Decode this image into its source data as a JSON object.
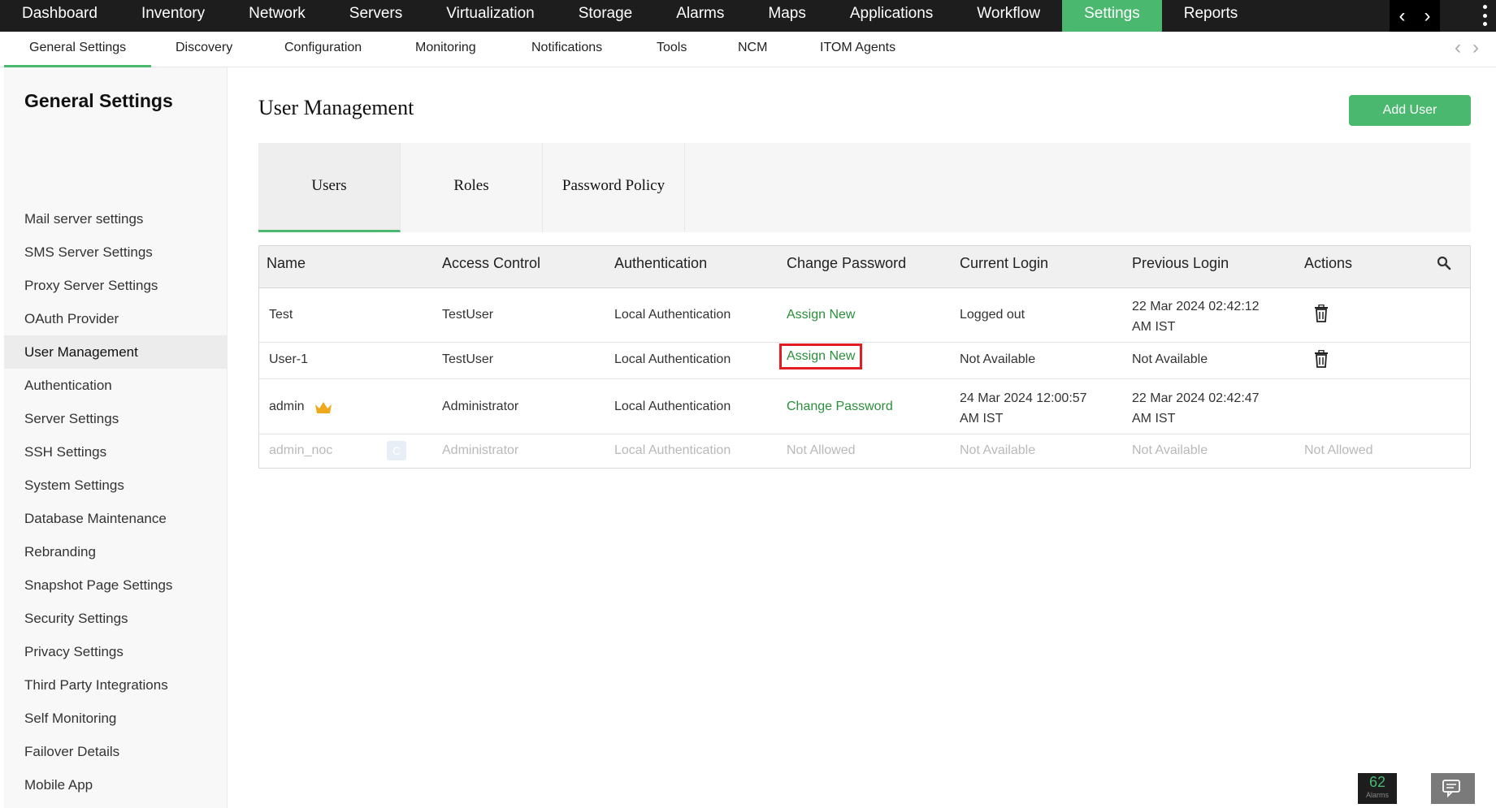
{
  "topnav": {
    "items": [
      "Dashboard",
      "Inventory",
      "Network",
      "Servers",
      "Virtualization",
      "Storage",
      "Alarms",
      "Maps",
      "Applications",
      "Workflow",
      "Settings",
      "Reports"
    ],
    "active": "Settings"
  },
  "subnav": {
    "items": [
      "General Settings",
      "Discovery",
      "Configuration",
      "Monitoring",
      "Notifications",
      "Tools",
      "NCM",
      "ITOM Agents"
    ],
    "active": "General Settings"
  },
  "sidebar": {
    "title": "General Settings",
    "items": [
      "Mail server settings",
      "SMS Server Settings",
      "Proxy Server Settings",
      "OAuth Provider",
      "User Management",
      "Authentication",
      "Server Settings",
      "SSH Settings",
      "System Settings",
      "Database Maintenance",
      "Rebranding",
      "Snapshot Page Settings",
      "Security Settings",
      "Privacy Settings",
      "Third Party Integrations",
      "Self Monitoring",
      "Failover Details",
      "Mobile App"
    ],
    "active": "User Management"
  },
  "main": {
    "title": "User Management",
    "add_user_label": "Add User",
    "tabs": [
      "Users",
      "Roles",
      "Password Policy"
    ],
    "active_tab": "Users"
  },
  "table": {
    "headers": [
      "Name",
      "Access Control",
      "Authentication",
      "Change Password",
      "Current Login",
      "Previous Login",
      "Actions"
    ],
    "rows": [
      {
        "name": "Test",
        "access": "TestUser",
        "auth": "Local Authentication",
        "password": "Assign New",
        "current": "Logged out",
        "previous": "22 Mar 2024 02:42:12 AM IST",
        "actions": "delete"
      },
      {
        "name": "User-1",
        "access": "TestUser",
        "auth": "Local Authentication",
        "password": "Assign New",
        "current": "Not Available",
        "previous": "Not Available",
        "actions": "delete"
      },
      {
        "name": "admin",
        "access": "Administrator",
        "auth": "Local Authentication",
        "password": "Change Password",
        "current": "24 Mar 2024 12:00:57 AM IST",
        "previous": "22 Mar 2024 02:42:47 AM IST",
        "actions": ""
      },
      {
        "name": "admin_noc",
        "badge": "C",
        "access": "Administrator",
        "auth": "Local Authentication",
        "password": "Not Allowed",
        "current": "Not Available",
        "previous": "Not Available",
        "actions": "Not Allowed"
      }
    ]
  },
  "footer": {
    "alarm_count": "62",
    "alarm_label": "Alarms"
  },
  "colors": {
    "accent": "#4ab86f",
    "link_green": "#2a8f3a",
    "highlight_red": "#e31b23",
    "topnav_bg": "#1d1d1d"
  },
  "icons": [
    "chevron-left-icon",
    "chevron-right-icon",
    "kebab-menu-icon",
    "search-icon",
    "trash-icon",
    "crown-icon",
    "chat-icon"
  ]
}
